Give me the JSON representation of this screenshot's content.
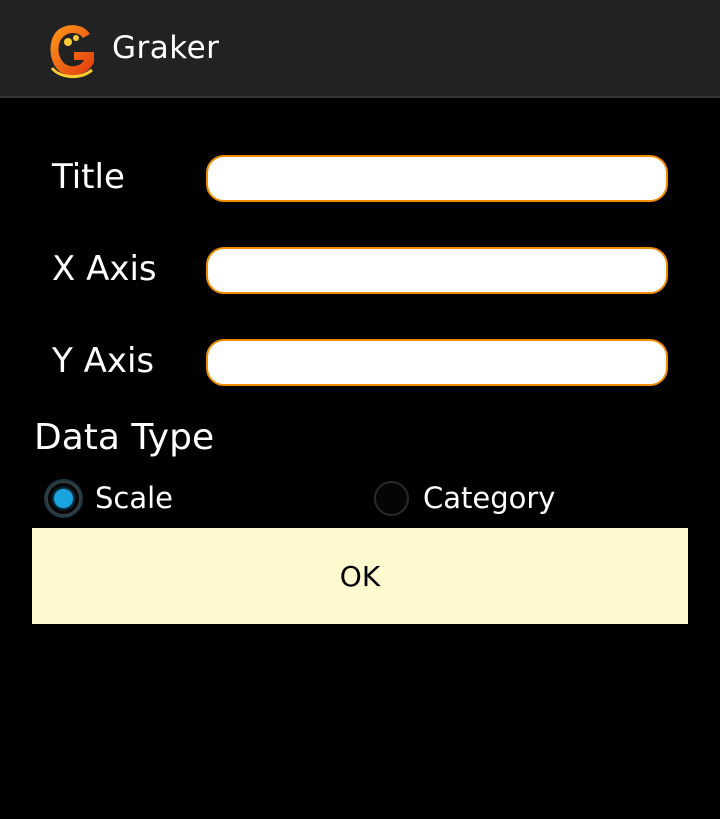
{
  "app_bar": {
    "title": "Graker",
    "logo_icon": "graker-logo-icon",
    "logo_colors": {
      "primary": "#f07d00",
      "secondary": "#e23a10",
      "accent": "#ffcc33"
    }
  },
  "form": {
    "fields": [
      {
        "label": "Title",
        "value": "",
        "placeholder": ""
      },
      {
        "label": "X Axis",
        "value": "",
        "placeholder": ""
      },
      {
        "label": "Y Axis",
        "value": "",
        "placeholder": ""
      }
    ],
    "field_border_color": "#f08c00"
  },
  "data_type": {
    "heading": "Data Type",
    "options": [
      {
        "label": "Scale",
        "selected": true
      },
      {
        "label": "Category",
        "selected": false
      }
    ],
    "selected_color": "#1aa3e0"
  },
  "ok_button": {
    "label": "OK",
    "background": "#fff9d0"
  }
}
